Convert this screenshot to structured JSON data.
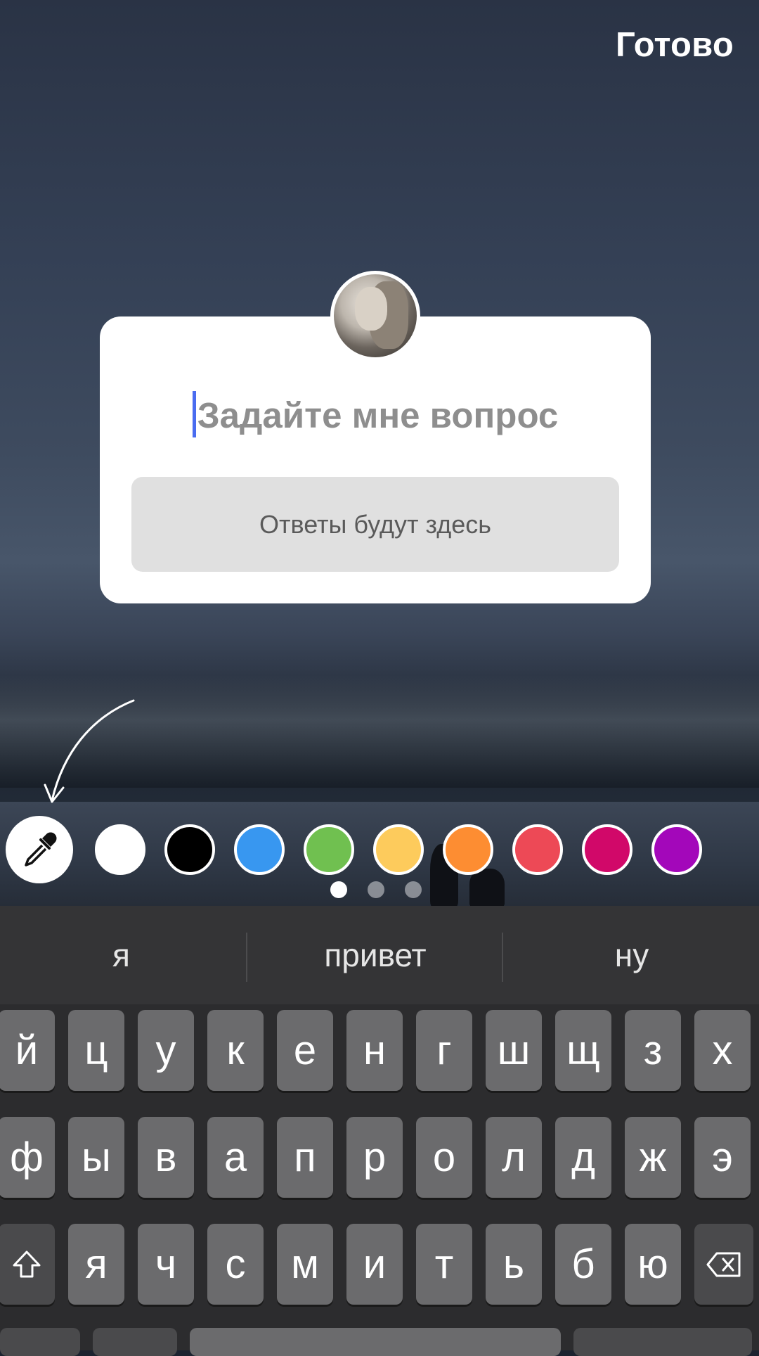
{
  "header": {
    "done_label": "Готово"
  },
  "sticker": {
    "question_placeholder": "Задайте мне вопрос",
    "answers_label": "Ответы будут здесь"
  },
  "palette": {
    "colors": [
      "#ffffff",
      "#000000",
      "#3897f0",
      "#70c050",
      "#fdcb5c",
      "#fd8d32",
      "#ed4956",
      "#d10869",
      "#a307ba"
    ],
    "eyedropper_icon": "eyedropper-icon",
    "page_dots": {
      "count": 3,
      "active_index": 0
    }
  },
  "keyboard": {
    "suggestions": [
      "я",
      "привет",
      "ну"
    ],
    "row1": [
      "й",
      "ц",
      "у",
      "к",
      "е",
      "н",
      "г",
      "ш",
      "щ",
      "з",
      "х"
    ],
    "row2": [
      "ф",
      "ы",
      "в",
      "а",
      "п",
      "р",
      "о",
      "л",
      "д",
      "ж",
      "э"
    ],
    "row3": [
      "я",
      "ч",
      "с",
      "м",
      "и",
      "т",
      "ь",
      "б",
      "ю"
    ],
    "shift_icon": "shift-icon",
    "backspace_icon": "backspace-icon"
  }
}
